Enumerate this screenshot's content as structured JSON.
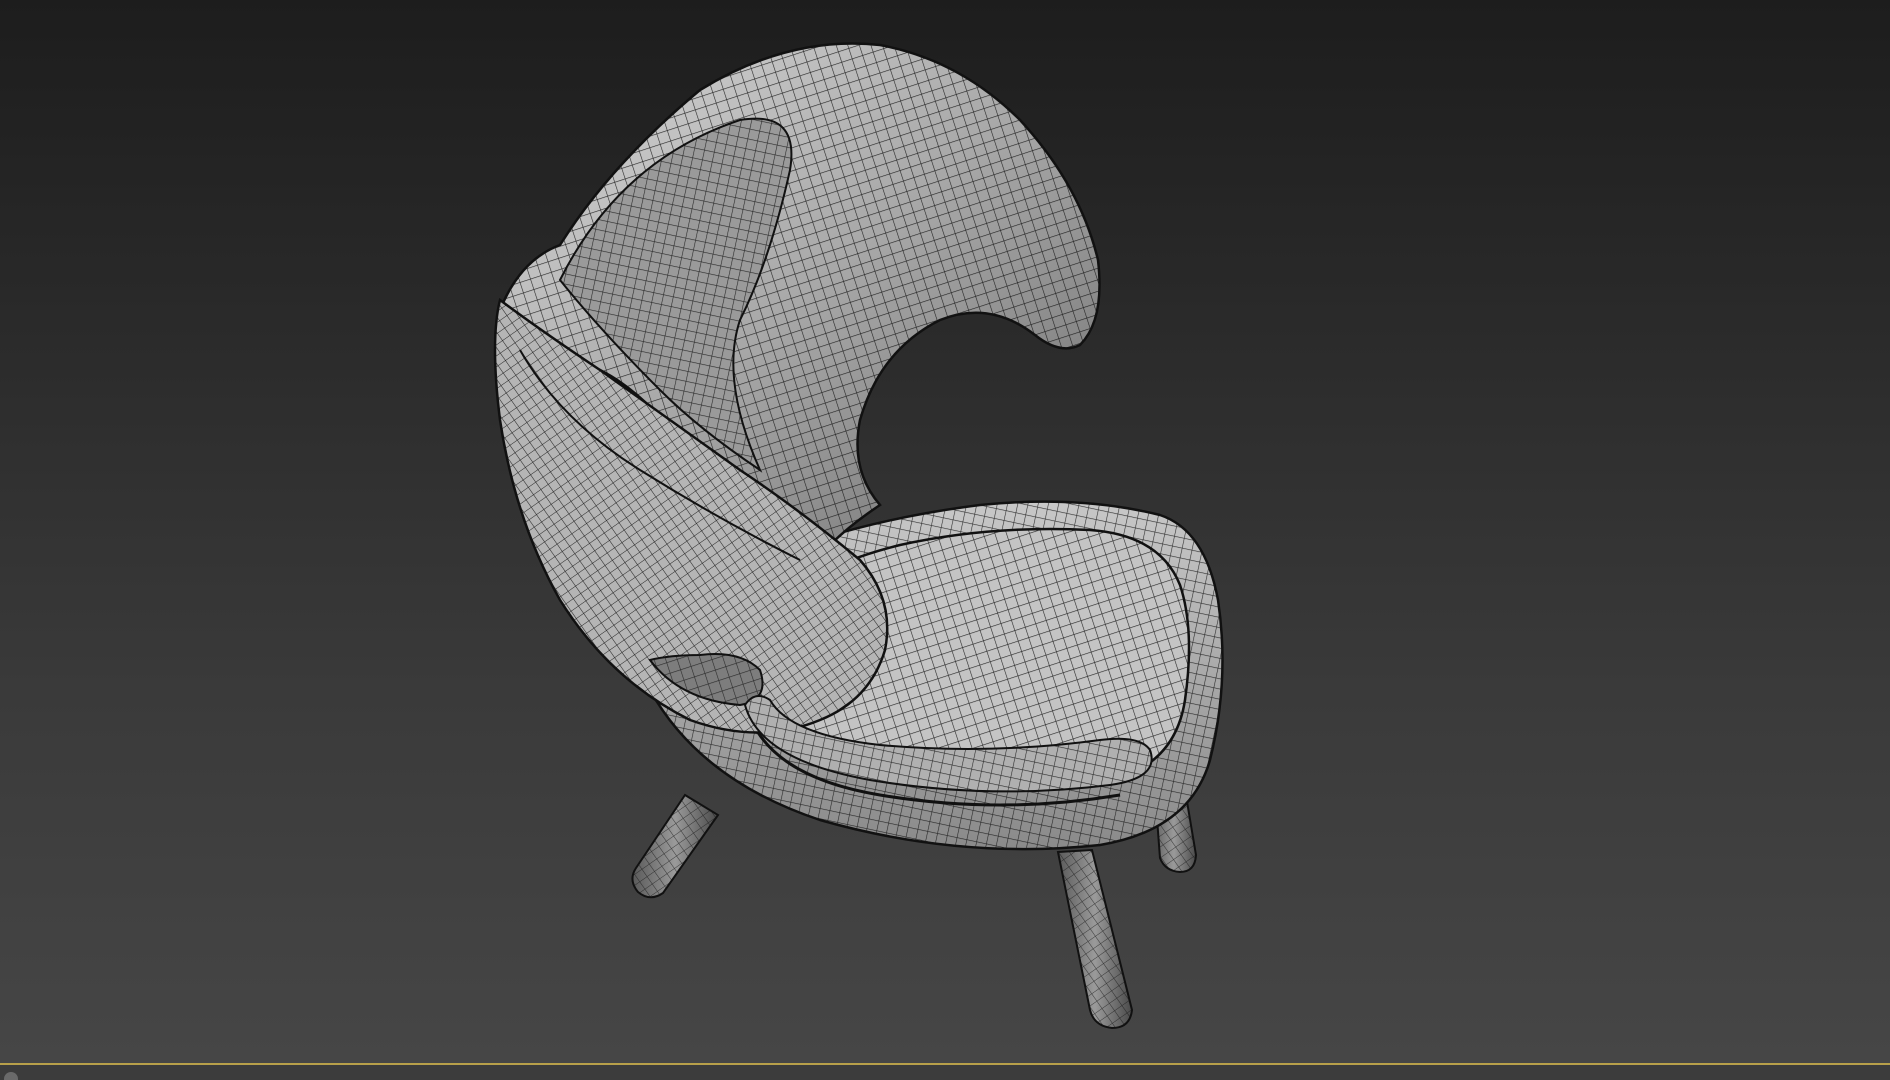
{
  "app": {
    "view": "perspective-viewport",
    "shading_mode": "wireframe-over-shaded"
  },
  "scene": {
    "object": "lounge-chair",
    "mesh_color": "#a9a9a9",
    "wire_color": "#111111"
  },
  "colors": {
    "viewport_top": "#1d1d1d",
    "viewport_bottom": "#464646",
    "active_border": "#b8a04a"
  }
}
